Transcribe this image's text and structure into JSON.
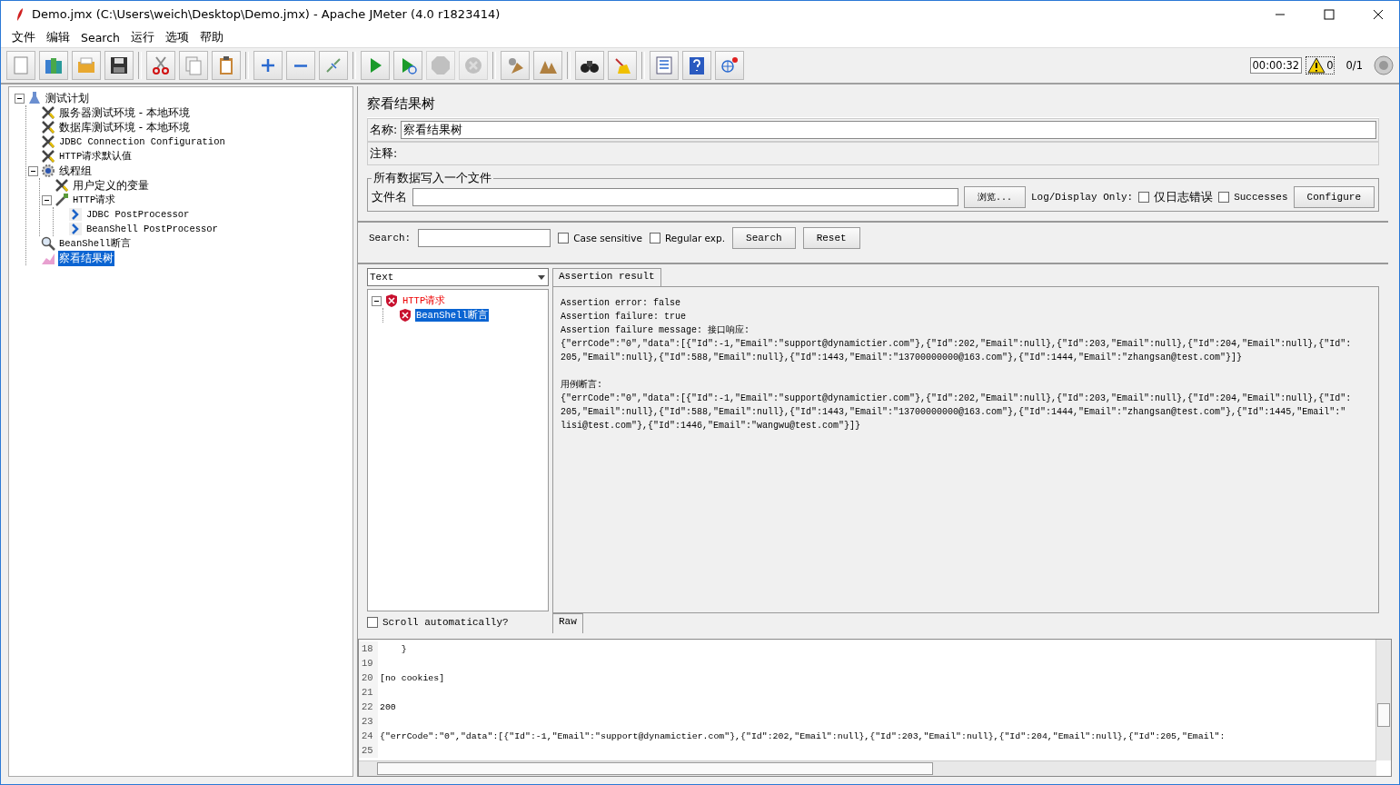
{
  "window": {
    "title": "Demo.jmx (C:\\Users\\weich\\Desktop\\Demo.jmx) - Apache JMeter (4.0 r1823414)"
  },
  "menu": [
    "文件",
    "编辑",
    "Search",
    "运行",
    "选项",
    "帮助"
  ],
  "toolbar": [
    {
      "kind": "new",
      "disabled": false
    },
    {
      "kind": "templates",
      "disabled": false
    },
    {
      "kind": "open",
      "disabled": false
    },
    {
      "kind": "save",
      "disabled": false
    },
    {
      "kind": "separator"
    },
    {
      "kind": "cut",
      "disabled": false
    },
    {
      "kind": "copy",
      "disabled": false
    },
    {
      "kind": "paste",
      "disabled": false
    },
    {
      "kind": "separator"
    },
    {
      "kind": "expand",
      "disabled": false
    },
    {
      "kind": "collapse",
      "disabled": false
    },
    {
      "kind": "toggle",
      "disabled": false
    },
    {
      "kind": "separator"
    },
    {
      "kind": "start",
      "disabled": false
    },
    {
      "kind": "start-no-pause",
      "disabled": false
    },
    {
      "kind": "stop",
      "disabled": true
    },
    {
      "kind": "shutdown",
      "disabled": true
    },
    {
      "kind": "separator"
    },
    {
      "kind": "clear",
      "disabled": false
    },
    {
      "kind": "clear-all",
      "disabled": false
    },
    {
      "kind": "separator"
    },
    {
      "kind": "search",
      "disabled": false
    },
    {
      "kind": "reset-search",
      "disabled": false
    },
    {
      "kind": "separator"
    },
    {
      "kind": "functions",
      "disabled": false
    },
    {
      "kind": "help",
      "disabled": false
    },
    {
      "kind": "logger",
      "disabled": false
    }
  ],
  "status": {
    "timer": "00:00:32",
    "warnings": "0",
    "threads": "0/1"
  },
  "tree": [
    {
      "label": "测试计划",
      "kind": "plan",
      "expanded": true,
      "selected": false,
      "children": [
        {
          "label": "服务器测试环境 - 本地环境",
          "kind": "config",
          "selected": false
        },
        {
          "label": "数据库测试环境 - 本地环境",
          "kind": "config",
          "selected": false
        },
        {
          "label": "JDBC Connection Configuration",
          "kind": "config",
          "selected": false
        },
        {
          "label": "HTTP请求默认值",
          "kind": "config",
          "selected": false
        },
        {
          "label": "线程组",
          "kind": "thread-group",
          "expanded": true,
          "selected": false,
          "children": [
            {
              "label": "用户定义的变量",
              "kind": "config",
              "selected": false
            },
            {
              "label": "HTTP请求",
              "kind": "sampler",
              "expanded": true,
              "selected": false,
              "children": [
                {
                  "label": "JDBC PostProcessor",
                  "kind": "postprocessor",
                  "selected": false
                },
                {
                  "label": "BeanShell PostProcessor",
                  "kind": "postprocessor",
                  "selected": false
                }
              ]
            }
          ]
        },
        {
          "label": "BeanShell断言",
          "kind": "assertion",
          "selected": false
        },
        {
          "label": "察看结果树",
          "kind": "listener",
          "selected": true
        }
      ]
    }
  ],
  "panel": {
    "title": "察看结果树",
    "name_label": "名称:",
    "name_value": "察看结果树",
    "comment_label": "注释:",
    "file_group": "所有数据写入一个文件",
    "file_label": "文件名",
    "browse": "浏览...",
    "log_only": "Log/Display Only:",
    "options": [
      {
        "label": "仅日志错误",
        "checked": false
      },
      {
        "label": "Successes",
        "checked": false
      }
    ],
    "configure": "Configure"
  },
  "search": {
    "label": "Search:",
    "options": [
      {
        "label": "Case sensitive",
        "checked": false
      },
      {
        "label": "Regular exp.",
        "checked": false
      }
    ],
    "buttons": [
      "Search",
      "Reset"
    ]
  },
  "results": {
    "renderer": "Text",
    "tree": [
      {
        "label": "HTTP请求",
        "failed": true,
        "expanded": true,
        "selected": false,
        "children": [
          {
            "label": "BeanShell断言",
            "failed": true,
            "selected": true
          }
        ]
      }
    ],
    "scroll_auto": {
      "label": "Scroll automatically?",
      "checked": false
    },
    "tabs": [
      {
        "label": "Assertion result",
        "selected": true
      }
    ],
    "bottom_tabs": [
      {
        "label": "Raw",
        "selected": true
      }
    ],
    "blocks": [
      [
        "Assertion error: false",
        "Assertion failure: true",
        "Assertion failure message: 接口响应:",
        "{\"errCode\":\"0\",\"data\":[{\"Id\":-1,\"Email\":\"support@dynamictier.com\"},{\"Id\":202,\"Email\":null},{\"Id\":203,\"Email\":null},{\"Id\":204,\"Email\":null},{\"Id\":",
        "205,\"Email\":null},{\"Id\":588,\"Email\":null},{\"Id\":1443,\"Email\":\"13700000000@163.com\"},{\"Id\":1444,\"Email\":\"zhangsan@test.com\"}]}"
      ],
      [
        "用例断言:",
        "{\"errCode\":\"0\",\"data\":[{\"Id\":-1,\"Email\":\"support@dynamictier.com\"},{\"Id\":202,\"Email\":null},{\"Id\":203,\"Email\":null},{\"Id\":204,\"Email\":null},{\"Id\":",
        "205,\"Email\":null},{\"Id\":588,\"Email\":null},{\"Id\":1443,\"Email\":\"13700000000@163.com\"},{\"Id\":1444,\"Email\":\"zhangsan@test.com\"},{\"Id\":1445,\"Email\":\"",
        "lisi@test.com\"},{\"Id\":1446,\"Email\":\"wangwu@test.com\"}]}"
      ]
    ]
  },
  "log": [
    {
      "number": "18",
      "text": "    }"
    },
    {
      "number": "19"
    },
    {
      "number": "20",
      "text": "[no cookies]"
    },
    {
      "number": "21"
    },
    {
      "number": "22",
      "text": "200"
    },
    {
      "number": "23"
    },
    {
      "number": "24",
      "text": "{\"errCode\":\"0\",\"data\":[{\"Id\":-1,\"Email\":\"support@dynamictier.com\"},{\"Id\":202,\"Email\":null},{\"Id\":203,\"Email\":null},{\"Id\":204,\"Email\":null},{\"Id\":205,\"Email\":"
    },
    {
      "number": "25"
    }
  ]
}
